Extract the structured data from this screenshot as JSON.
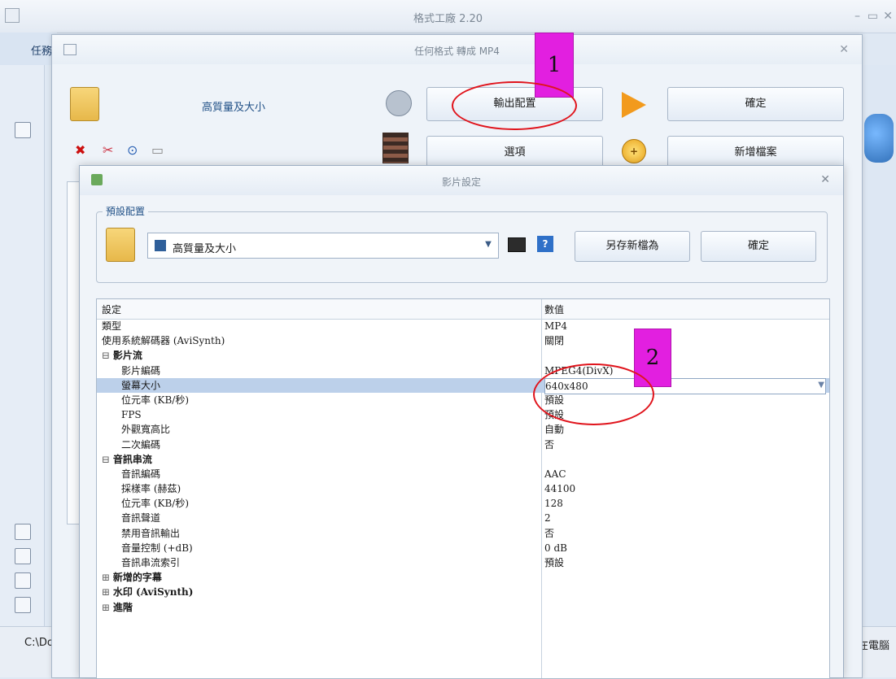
{
  "main_window": {
    "title": "格式工廠 2.20",
    "menu_label": "任務",
    "status_path": "C:\\Doc",
    "status_right": "在電腦"
  },
  "dialog1": {
    "title": "任何格式 轉成 MP4",
    "preset_name": "高質量及大小",
    "output_config_label": "輸出配置",
    "ok_label": "確定",
    "options_label": "選項",
    "add_file_label": "新增檔案"
  },
  "annotations": {
    "marker1": "1",
    "marker2": "2",
    "accent_color": "#e21fe0",
    "oval_color": "#e0141c"
  },
  "dialog2": {
    "title": "影片設定",
    "preset_group_label": "預設配置",
    "preset_value": "高質量及大小",
    "save_as_label": "另存新檔為",
    "ok_label": "確定",
    "grid": {
      "headers": {
        "setting": "設定",
        "value": "數值"
      },
      "rows": [
        {
          "key": "類型",
          "value": "MP4"
        },
        {
          "key": "使用系統解碼器 (AviSynth)",
          "value": "關閉"
        },
        {
          "key": "影片流",
          "value": "",
          "group": true
        },
        {
          "key": "影片編碼",
          "value": "MPEG4(DivX)",
          "child": true
        },
        {
          "key": "螢幕大小",
          "value": "640x480",
          "child": true,
          "selected": true
        },
        {
          "key": "位元率 (KB/秒)",
          "value": "預設",
          "child": true
        },
        {
          "key": "FPS",
          "value": "預設",
          "child": true
        },
        {
          "key": "外觀寬高比",
          "value": "自動",
          "child": true
        },
        {
          "key": "二次編碼",
          "value": "否",
          "child": true
        },
        {
          "key": "音訊串流",
          "value": "",
          "group": true
        },
        {
          "key": "音訊編碼",
          "value": "AAC",
          "child": true
        },
        {
          "key": "採樣率 (赫茲)",
          "value": "44100",
          "child": true
        },
        {
          "key": "位元率 (KB/秒)",
          "value": "128",
          "child": true
        },
        {
          "key": "音訊聲道",
          "value": "2",
          "child": true
        },
        {
          "key": "禁用音訊輸出",
          "value": "否",
          "child": true
        },
        {
          "key": "音量控制 (+dB)",
          "value": "0 dB",
          "child": true
        },
        {
          "key": "音訊串流索引",
          "value": "預設",
          "child": true
        },
        {
          "key": "新增的字幕",
          "value": "",
          "group": true,
          "closed": true
        },
        {
          "key": "水印 (AviSynth)",
          "value": "",
          "group": true,
          "closed": true
        },
        {
          "key": "進階",
          "value": "",
          "group": true,
          "closed": true
        }
      ]
    }
  }
}
